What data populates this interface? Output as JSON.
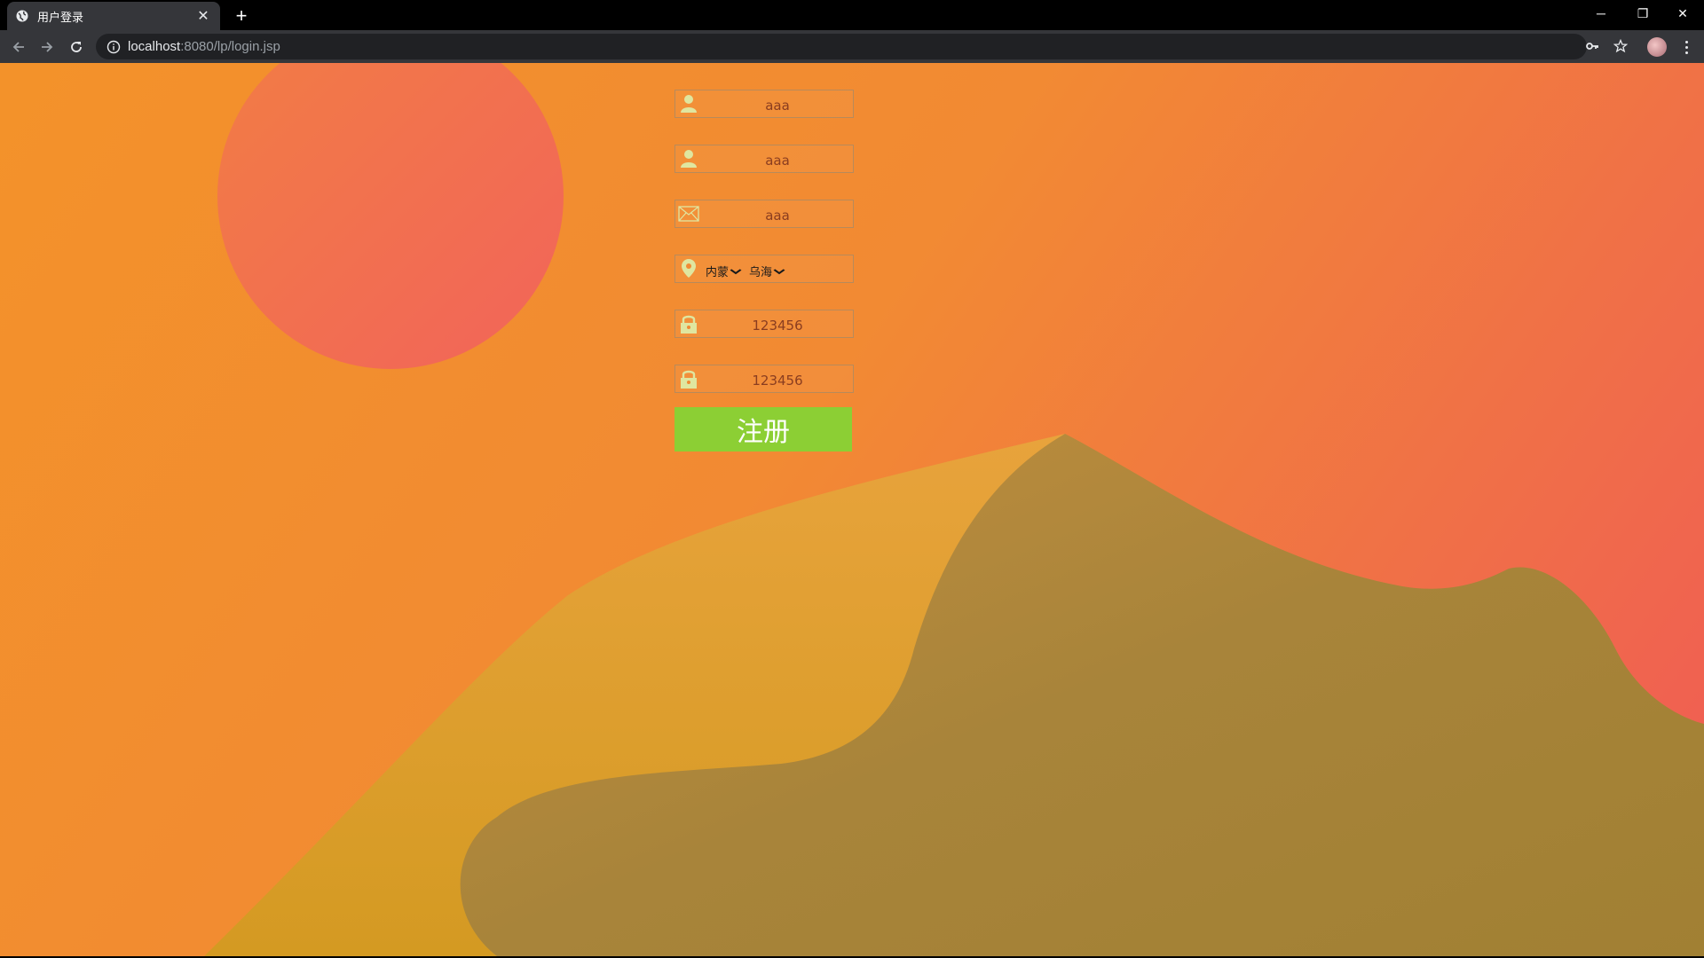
{
  "browser": {
    "tab_title": "用户登录",
    "tab_close": "✕",
    "new_tab": "+",
    "url_host": "localhost",
    "url_path": ":8080/lp/login.jsp",
    "window_controls": {
      "minimize": "─",
      "restore": "❐",
      "close": "✕"
    }
  },
  "form": {
    "fields": [
      {
        "icon": "user-icon",
        "value": "aaa"
      },
      {
        "icon": "user-icon",
        "value": "aaa"
      },
      {
        "icon": "mail-icon",
        "value": "aaa"
      },
      {
        "icon": "location-icon",
        "province": "内蒙",
        "city": "乌海"
      },
      {
        "icon": "lock-icon",
        "value": "123456"
      },
      {
        "icon": "lock-icon",
        "value": "123456"
      }
    ],
    "submit_label": "注册"
  },
  "colors": {
    "accent_button": "#8ccf34",
    "background_orange": "#f3922a",
    "background_red": "#f05a55",
    "icon": "#dfe6a0"
  }
}
